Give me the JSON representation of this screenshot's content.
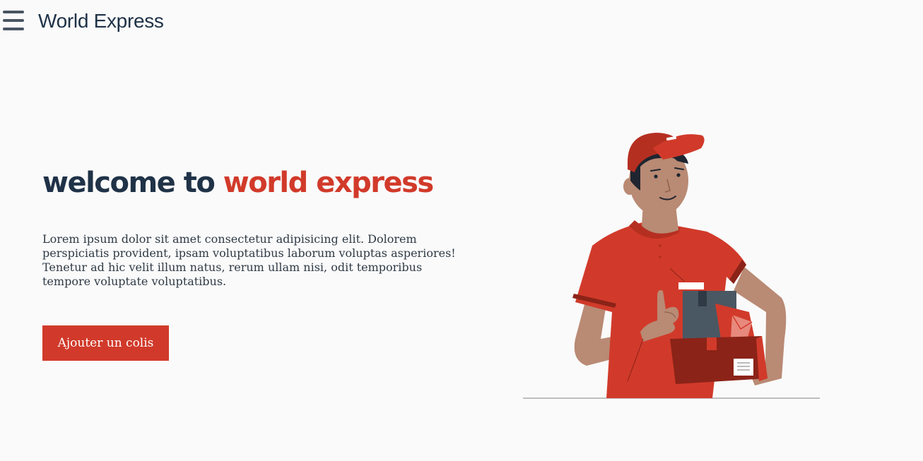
{
  "header": {
    "menu_icon": "hamburger-menu-icon",
    "brand": "World Express"
  },
  "hero": {
    "title_part1": "welcome to",
    "title_part2": "world express",
    "description": "Lorem ipsum dolor sit amet consectetur adipisicing elit. Dolorem perspiciatis provident, ipsam voluptatibus laborum voluptas asperiores! Tenetur ad hic velit illum natus, rerum ullam nisi, odit temporibus tempore voluptate voluptatibus.",
    "cta_label": "Ajouter un colis"
  },
  "colors": {
    "accent": "#d13a2a",
    "dark": "#1f3247",
    "background": "#fafafa"
  }
}
